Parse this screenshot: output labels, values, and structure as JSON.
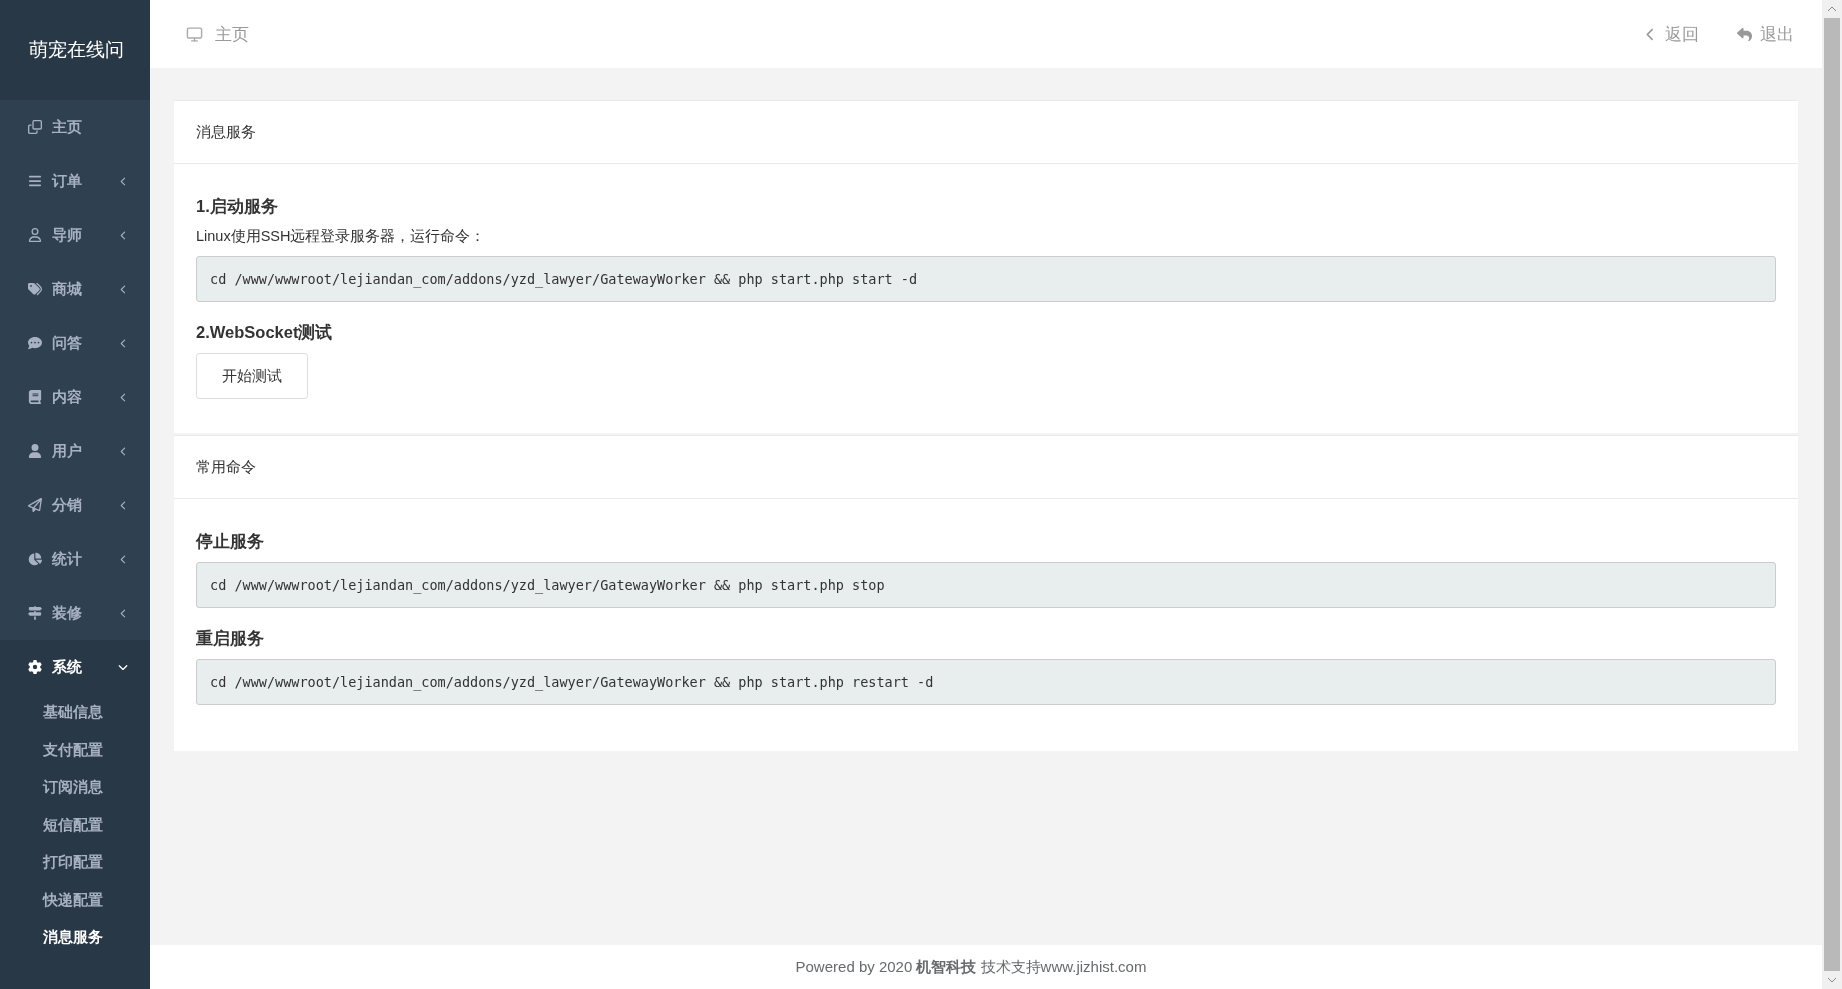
{
  "brand": "萌宠在线问",
  "sidebar": {
    "items": [
      {
        "label": "主页"
      },
      {
        "label": "订单",
        "expanded": false
      },
      {
        "label": "导师",
        "expanded": false
      },
      {
        "label": "商城",
        "expanded": false
      },
      {
        "label": "问答",
        "expanded": false
      },
      {
        "label": "内容",
        "expanded": false
      },
      {
        "label": "用户",
        "expanded": false
      },
      {
        "label": "分销",
        "expanded": false
      },
      {
        "label": "统计",
        "expanded": false
      },
      {
        "label": "装修",
        "expanded": false
      },
      {
        "label": "系统",
        "expanded": true,
        "children": [
          {
            "label": "基础信息",
            "selected": false
          },
          {
            "label": "支付配置",
            "selected": false
          },
          {
            "label": "订阅消息",
            "selected": false
          },
          {
            "label": "短信配置",
            "selected": false
          },
          {
            "label": "打印配置",
            "selected": false
          },
          {
            "label": "快递配置",
            "selected": false
          },
          {
            "label": "消息服务",
            "selected": true
          }
        ]
      }
    ]
  },
  "header": {
    "breadcrumb": "主页",
    "back": "返回",
    "logout": "退出"
  },
  "cards": [
    {
      "title": "消息服务",
      "sections": [
        {
          "heading": "1.启动服务",
          "note": "Linux使用SSH远程登录服务器，运行命令：",
          "command": "cd /www/wwwroot/lejiandan_com/addons/yzd_lawyer/GatewayWorker && php start.php start -d"
        },
        {
          "heading": "2.WebSocket测试",
          "button": "开始测试"
        }
      ]
    },
    {
      "title": "常用命令",
      "sections": [
        {
          "heading": "停止服务",
          "command": "cd /www/wwwroot/lejiandan_com/addons/yzd_lawyer/GatewayWorker && php start.php stop"
        },
        {
          "heading": "重启服务",
          "command": "cd /www/wwwroot/lejiandan_com/addons/yzd_lawyer/GatewayWorker && php start.php restart -d"
        }
      ]
    }
  ],
  "footer": "Powered by 2020 **机智科技** 技术支持www.jizhist.com"
}
